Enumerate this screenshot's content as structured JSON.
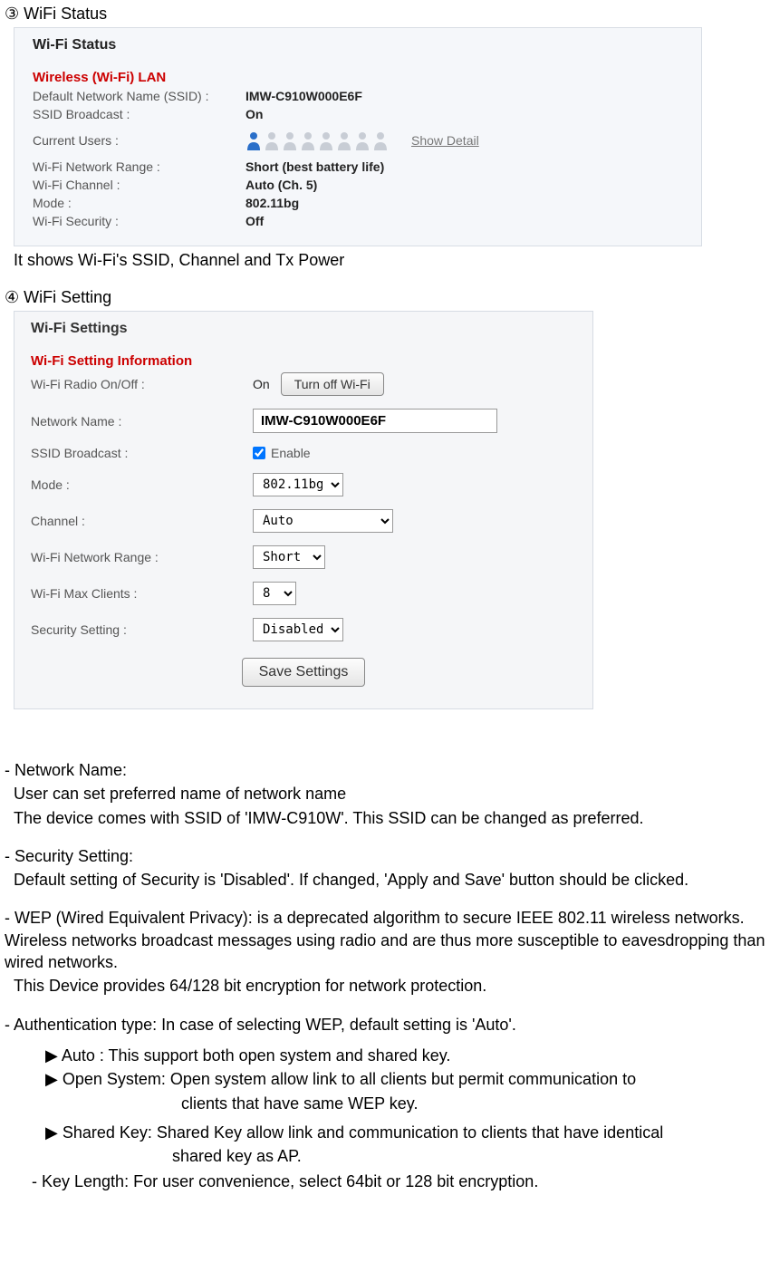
{
  "section3": {
    "num": "③",
    "title": "WiFi Status",
    "panel_header": "Wi-Fi Status",
    "sub_header": "Wireless (Wi-Fi) LAN",
    "ssid_label": "Default Network Name (SSID) :",
    "ssid_value": "IMW-C910W000E6F",
    "broadcast_label": "SSID Broadcast :",
    "broadcast_value": "On",
    "users_label": "Current Users :",
    "show_detail": "Show Detail",
    "range_label": "Wi-Fi Network Range :",
    "range_value": "Short (best battery life)",
    "channel_label": "Wi-Fi Channel :",
    "channel_value": "Auto (Ch. 5)",
    "mode_label": "Mode :",
    "mode_value": "802.11bg",
    "security_label": "Wi-Fi Security :",
    "security_value": "Off",
    "caption": "It shows Wi-Fi's SSID, Channel and Tx Power"
  },
  "section4": {
    "num": "④",
    "title": "WiFi Setting",
    "panel_header": "Wi-Fi Settings",
    "sub_header": "Wi-Fi Setting Information",
    "radio_label": "Wi-Fi Radio On/Off :",
    "radio_value": "On",
    "turnoff_btn": "Turn off Wi-Fi",
    "name_label": "Network Name :",
    "name_value": "IMW-C910W000E6F",
    "broadcast_label": "SSID Broadcast :",
    "broadcast_enable": "Enable",
    "mode_label": "Mode :",
    "mode_value": "802.11bg",
    "channel_label": "Channel :",
    "channel_value": "Auto",
    "range_label": "Wi-Fi Network Range :",
    "range_value": "Short",
    "max_label": "Wi-Fi Max Clients :",
    "max_value": "8",
    "sec_label": "Security Setting :",
    "sec_value": "Disabled",
    "save_btn": "Save Settings"
  },
  "doc": {
    "net_name_h": "- Network Name:",
    "net_name_1": "User can set preferred name of network name",
    "net_name_2": "The device comes with SSID of 'IMW-C910W'. This SSID can be changed as preferred.",
    "sec_h": "- Security Setting:",
    "sec_1": "Default setting of Security is 'Disabled'. If changed, 'Apply and Save' button should be clicked.",
    "wep_1": "- WEP (Wired Equivalent Privacy): is a deprecated algorithm to secure IEEE 802.11 wireless networks. Wireless networks broadcast messages using radio and are thus more susceptible to eavesdropping than wired networks.",
    "wep_2": "This Device provides 64/128 bit encryption for network protection.",
    "auth_h": "- Authentication type: In case of selecting WEP, default setting is 'Auto'.",
    "auto_b": "▶ Auto : This support both open system and shared key.",
    "open_b1": "▶ Open System: Open system allow link to all clients but permit communication to",
    "open_b2": "clients that have same WEP key.",
    "shared_b1": "▶ Shared Key: Shared Key allow link and communication to clients that have identical",
    "shared_b2": "shared key as AP.",
    "keylen": "- Key Length: For user convenience, select 64bit or 128 bit encryption."
  }
}
